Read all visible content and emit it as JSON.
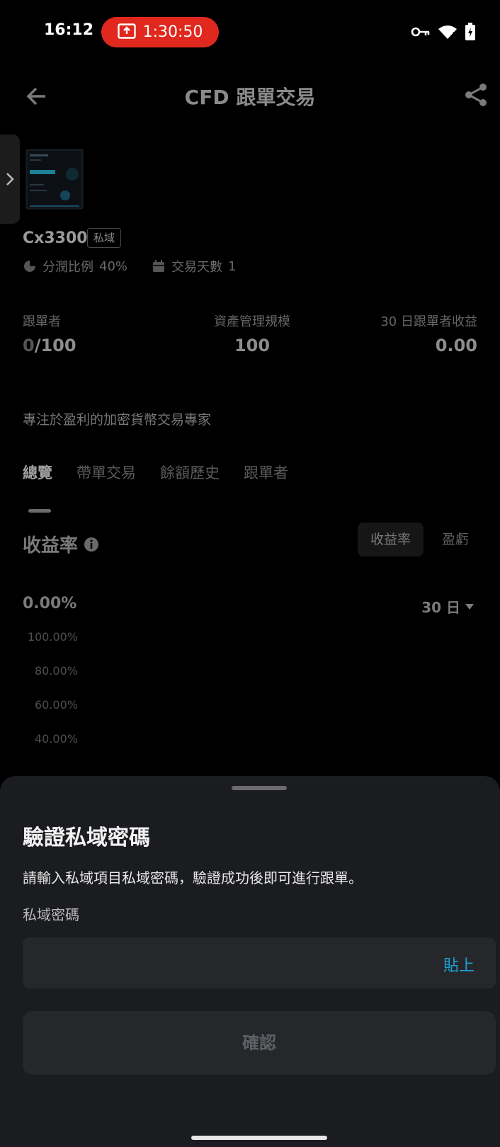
{
  "status_bar": {
    "time": "16:12",
    "recording_time": "1:30:50"
  },
  "header": {
    "title": "CFD 跟單交易"
  },
  "trader": {
    "name": "Cx3300",
    "badge": "私域",
    "profit_share_label": "分潤比例",
    "profit_share_value": "40%",
    "trading_days_label": "交易天數",
    "trading_days_value": "1"
  },
  "stats": {
    "followers_label": "跟單者",
    "followers_current": "0",
    "followers_max": "/100",
    "aum_label": "資產管理規模",
    "aum_value": "100",
    "follower_pnl_label": "30 日跟單者收益",
    "follower_pnl_value": "0.00"
  },
  "description": "專注於盈利的加密貨幣交易專家",
  "tabs": [
    "總覽",
    "帶單交易",
    "餘額歷史",
    "跟單者"
  ],
  "performance": {
    "title": "收益率",
    "toggle_options": [
      "收益率",
      "盈虧"
    ],
    "value": "0.00%",
    "period": "30 日",
    "y_labels": [
      "100.00%",
      "80.00%",
      "60.00%",
      "40.00%"
    ]
  },
  "sheet": {
    "title": "驗證私域密碼",
    "description": "請輸入私域項目私域密碼，驗證成功後即可進行跟單。",
    "field_label": "私域密碼",
    "field_value": "",
    "paste_label": "貼上",
    "confirm_label": "確認"
  },
  "colors": {
    "accent": "#1aa3d9",
    "recording": "#e0281e",
    "sheet_bg": "#1b1c1f"
  }
}
